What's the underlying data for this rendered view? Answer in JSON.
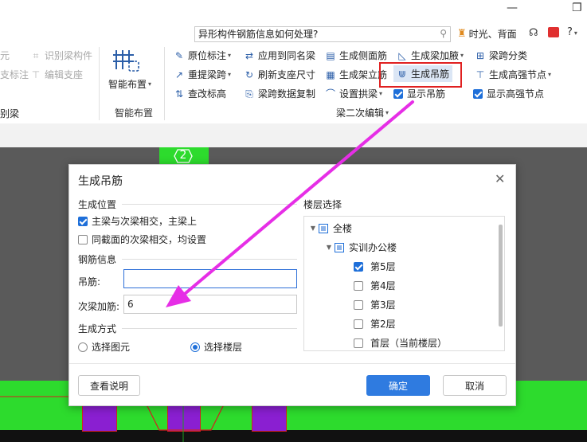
{
  "window": {
    "minimize_glyph": "—",
    "restore_glyph": "❐"
  },
  "search": {
    "value": "异形构件钢筋信息如何处理?",
    "icon": "search-icon"
  },
  "topbar": {
    "user_label": "时光、背面",
    "help_label": "?"
  },
  "ribbon": {
    "left_items": [
      "元",
      "识别梁构件",
      "支标注",
      "编辑支座",
      "别梁"
    ],
    "smart_layout_label": "智能布置",
    "smart_layout_group": "智能布置",
    "col1": [
      "原位标注",
      "重提梁跨",
      "查改标高"
    ],
    "col2": [
      "应用到同名梁",
      "刷新支座尺寸",
      "梁跨数据复制"
    ],
    "col3": [
      "生成侧面筋",
      "生成架立筋",
      "设置拱梁"
    ],
    "col4": [
      "生成梁加腋",
      "生成吊筋",
      "显示吊筋"
    ],
    "col5": [
      "梁跨分类",
      "生成高强节点",
      "显示高强节点"
    ],
    "group_label": "梁二次编辑"
  },
  "canvas": {
    "axis_label": "2"
  },
  "dialog": {
    "title": "生成吊筋",
    "close_glyph": "✕",
    "position_section": "生成位置",
    "opt_main_secondary": "主梁与次梁相交，主梁上",
    "opt_same_section": "同截面的次梁相交，均设置",
    "rebar_section": "钢筋信息",
    "hanger_label": "吊筋:",
    "hanger_value": "",
    "secondary_label": "次梁加筋:",
    "secondary_value": "6",
    "method_section": "生成方式",
    "method_select_element": "选择图元",
    "method_select_floor": "选择楼层",
    "floor_section": "楼层选择",
    "tree": {
      "all": "全楼",
      "project": "实训办公楼",
      "floors": [
        {
          "label": "第5层",
          "checked": true
        },
        {
          "label": "第4层",
          "checked": false
        },
        {
          "label": "第3层",
          "checked": false
        },
        {
          "label": "第2层",
          "checked": false
        },
        {
          "label": "首层（当前楼层）",
          "checked": false
        }
      ]
    },
    "help_button": "查看说明",
    "ok_button": "确定",
    "cancel_button": "取消"
  },
  "colors": {
    "accent": "#2f7be0",
    "highlight_border": "#e02020",
    "arrow": "#e62ee6",
    "canvas_green": "#2ddb2d",
    "canvas_purple": "#8a1fd1"
  }
}
